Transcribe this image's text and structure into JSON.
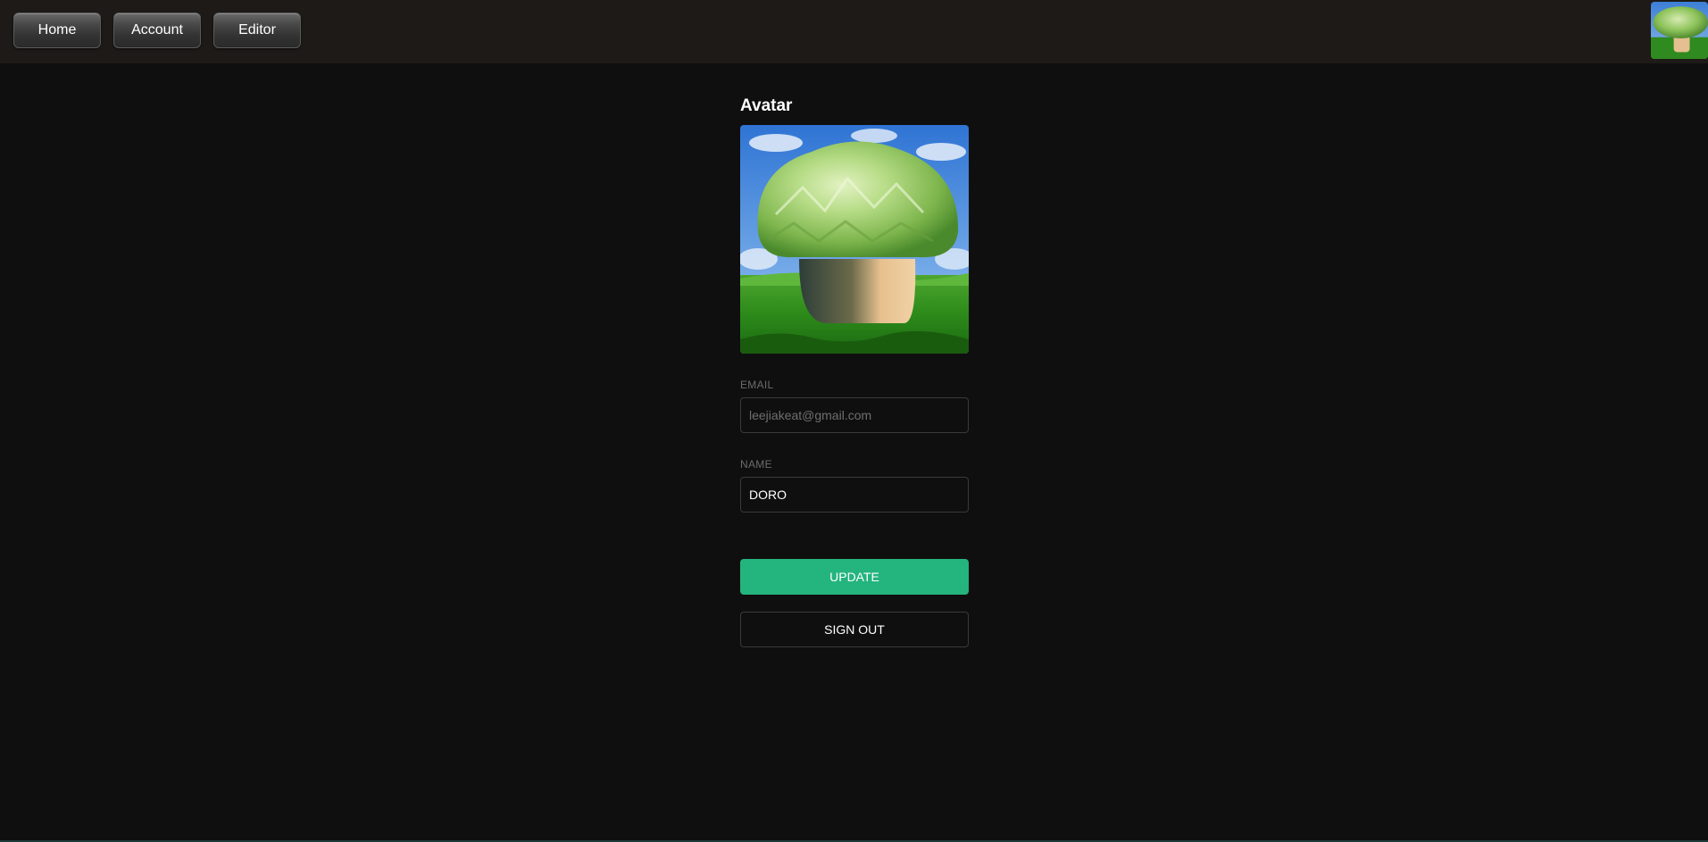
{
  "nav": {
    "home_label": "Home",
    "account_label": "Account",
    "editor_label": "Editor"
  },
  "profile": {
    "heading": "Avatar",
    "email_label": "EMAIL",
    "email_value": "leejiakeat@gmail.com",
    "name_label": "NAME",
    "name_value": "DORO",
    "update_label": "UPDATE",
    "signout_label": "SIGN OUT"
  },
  "colors": {
    "background": "#0f0f0f",
    "topbar": "#1d1a17",
    "accent": "#24b47e",
    "field_border": "#3a3a3a"
  }
}
